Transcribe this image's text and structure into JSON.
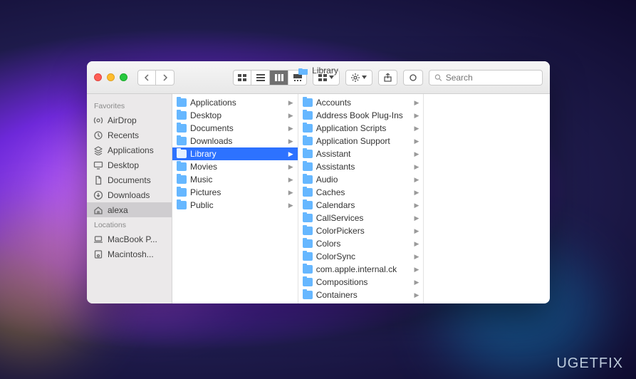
{
  "window": {
    "title": "Library"
  },
  "toolbar": {
    "search_placeholder": "Search"
  },
  "sidebar": {
    "sections": [
      {
        "header": "Favorites",
        "items": [
          {
            "icon": "airdrop",
            "label": "AirDrop"
          },
          {
            "icon": "recents",
            "label": "Recents"
          },
          {
            "icon": "apps",
            "label": "Applications"
          },
          {
            "icon": "desktop",
            "label": "Desktop"
          },
          {
            "icon": "documents",
            "label": "Documents"
          },
          {
            "icon": "downloads",
            "label": "Downloads"
          },
          {
            "icon": "home",
            "label": "alexa",
            "selected": true
          }
        ]
      },
      {
        "header": "Locations",
        "items": [
          {
            "icon": "laptop",
            "label": "MacBook P..."
          },
          {
            "icon": "disk",
            "label": "Macintosh..."
          }
        ]
      }
    ]
  },
  "columns": [
    {
      "items": [
        {
          "label": "Applications"
        },
        {
          "label": "Desktop"
        },
        {
          "label": "Documents"
        },
        {
          "label": "Downloads"
        },
        {
          "label": "Library",
          "selected": true
        },
        {
          "label": "Movies"
        },
        {
          "label": "Music"
        },
        {
          "label": "Pictures"
        },
        {
          "label": "Public"
        }
      ]
    },
    {
      "items": [
        {
          "label": "Accounts"
        },
        {
          "label": "Address Book Plug-Ins"
        },
        {
          "label": "Application Scripts"
        },
        {
          "label": "Application Support"
        },
        {
          "label": "Assistant"
        },
        {
          "label": "Assistants"
        },
        {
          "label": "Audio"
        },
        {
          "label": "Caches"
        },
        {
          "label": "Calendars"
        },
        {
          "label": "CallServices"
        },
        {
          "label": "ColorPickers"
        },
        {
          "label": "Colors"
        },
        {
          "label": "ColorSync"
        },
        {
          "label": "com.apple.internal.ck"
        },
        {
          "label": "Compositions"
        },
        {
          "label": "Containers"
        }
      ]
    },
    {
      "items": []
    }
  ],
  "watermark": "UGETFIX"
}
